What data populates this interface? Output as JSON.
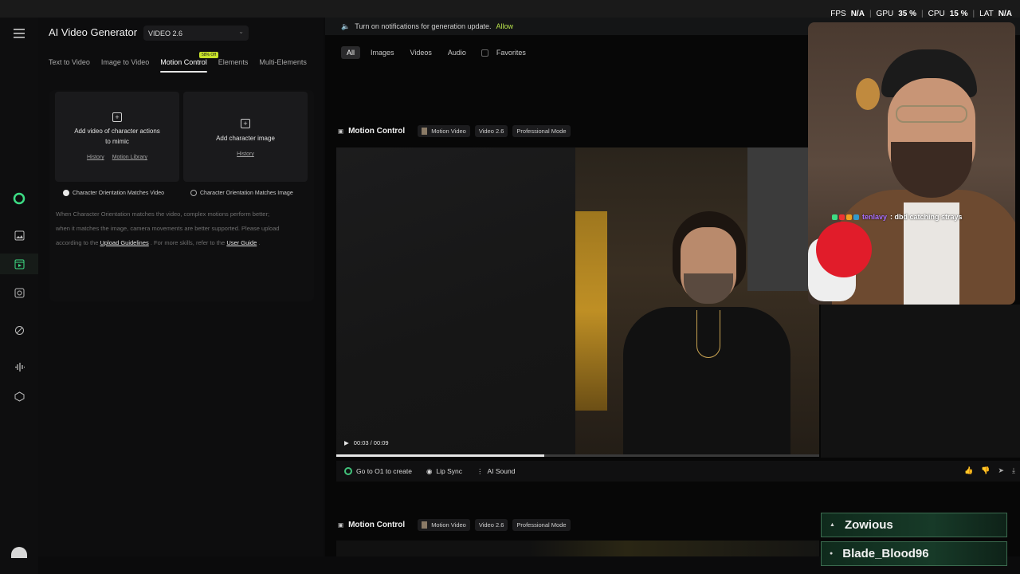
{
  "stats": {
    "fps_label": "FPS",
    "fps_value": "N/A",
    "gpu_label": "GPU",
    "gpu_value": "35 %",
    "cpu_label": "CPU",
    "cpu_value": "15 %",
    "lat_label": "LAT",
    "lat_value": "N/A"
  },
  "sidebar": {
    "items": [
      {
        "icon": "menu-icon"
      },
      {
        "icon": "logo-icon"
      },
      {
        "icon": "image-icon"
      },
      {
        "icon": "video-icon"
      },
      {
        "icon": "audio-icon"
      },
      {
        "icon": "brush-icon"
      },
      {
        "icon": "waveform-icon"
      },
      {
        "icon": "cube-icon"
      }
    ]
  },
  "panel": {
    "title": "AI Video Generator",
    "version": "VIDEO 2.6",
    "badge": "58% Off",
    "tabs": [
      "Text to Video",
      "Image to Video",
      "Motion Control",
      "Elements",
      "Multi-Elements"
    ],
    "active_tab": "Motion Control",
    "card_video": {
      "line1": "Add video of character actions",
      "line2": "to mimic",
      "link1": "History",
      "link2": "Motion Library"
    },
    "card_image": {
      "line1": "Add character image",
      "link1": "History"
    },
    "radio1": "Character Orientation Matches Video",
    "radio2": "Character Orientation Matches Image",
    "note_line1": "When Character Orientation matches the video, complex motions perform better;",
    "note_line2": "when it matches the image, camera movements are better supported. Please upload",
    "note_line3a": "according to the",
    "note_link1": "Upload Guidelines",
    "note_line3b": ". For more skills, refer to the",
    "note_link2": "User Guide",
    "note_line3c": "."
  },
  "main": {
    "notification": "Turn on notifications for generation update.",
    "notification_action": "Allow",
    "filters": [
      "All",
      "Images",
      "Videos",
      "Audio"
    ],
    "favorites": "Favorites",
    "generation": {
      "title": "Motion Control",
      "pills": [
        "Motion Video",
        "Video 2.6",
        "Professional Mode"
      ]
    },
    "video_time": "00:03 / 00:09",
    "progress": 0.43,
    "actions": [
      "Go to O1 to create",
      "Lip Sync",
      "AI Sound"
    ],
    "generation2": {
      "title": "Motion Control",
      "pills": [
        "Motion Video",
        "Video 2.6",
        "Professional Mode"
      ]
    }
  },
  "overlay": {
    "chat_user": "tenlavy",
    "chat_msg": ": dbd catching strays",
    "plates": [
      "Zowious",
      "Blade_Blood96"
    ]
  }
}
